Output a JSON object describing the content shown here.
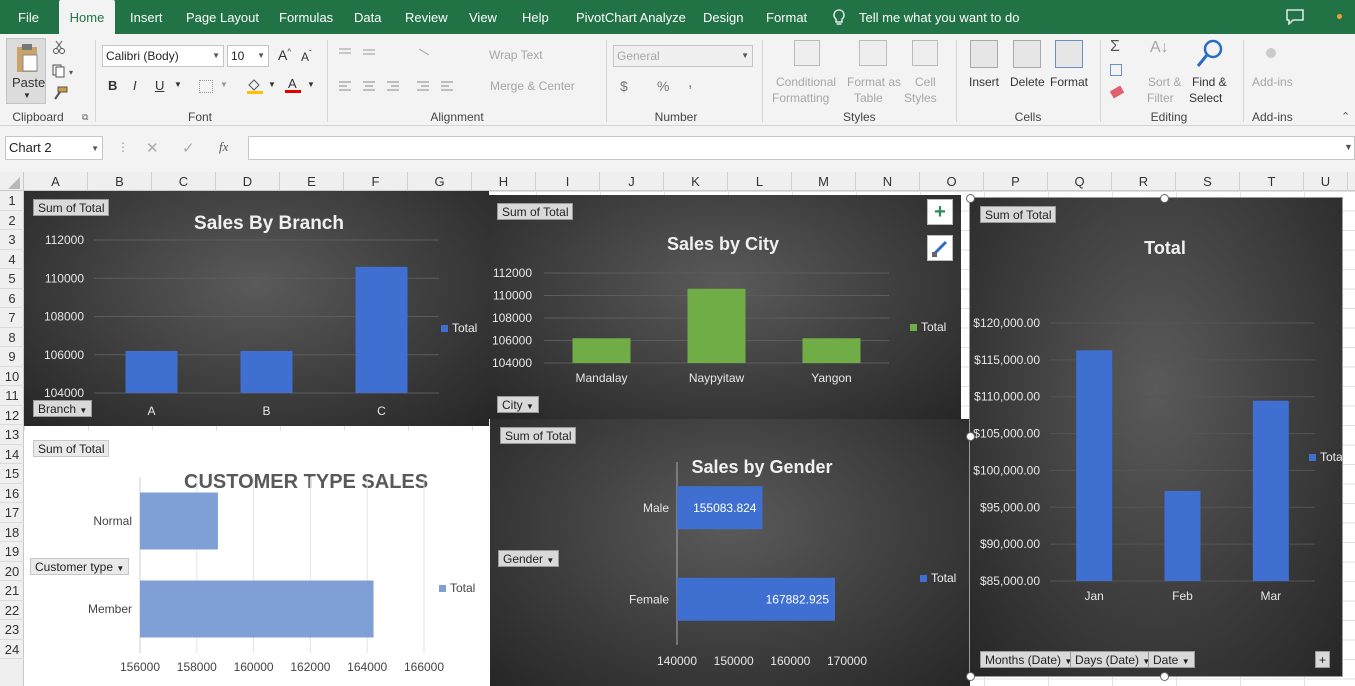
{
  "colors": {
    "excel_green": "#217346",
    "bar_blue": "#3f6fd1",
    "bar_green": "#70ad47",
    "bar_light_blue": "#7f9fd6"
  },
  "tabs": [
    "File",
    "Home",
    "Insert",
    "Page Layout",
    "Formulas",
    "Data",
    "Review",
    "View",
    "Help",
    "PivotChart Analyze",
    "Design",
    "Format"
  ],
  "active_tab": "Home",
  "tell_me": "Tell me what you want to do",
  "ribbon": {
    "clipboard": {
      "paste": "Paste",
      "label": "Clipboard"
    },
    "font": {
      "name": "Calibri (Body)",
      "size": "10",
      "bold": "B",
      "italic": "I",
      "underline": "U",
      "label": "Font"
    },
    "alignment": {
      "wrap": "Wrap Text",
      "merge": "Merge & Center",
      "label": "Alignment"
    },
    "number": {
      "format": "General",
      "currency": "$",
      "percent": "%",
      "comma": ",",
      "label": "Number"
    },
    "styles": {
      "conditional": [
        "Conditional",
        "Formatting"
      ],
      "format_table": [
        "Format as",
        "Table"
      ],
      "cell_styles": [
        "Cell",
        "Styles"
      ],
      "label": "Styles"
    },
    "cells": {
      "insert": "Insert",
      "delete": "Delete",
      "format": "Format",
      "label": "Cells"
    },
    "editing": {
      "sort": [
        "Sort &",
        "Filter"
      ],
      "find": [
        "Find &",
        "Select"
      ],
      "label": "Editing"
    },
    "addins": {
      "button": "Add-ins",
      "label": "Add-ins"
    }
  },
  "formula_bar": {
    "name_box": "Chart 2",
    "fx": "fx",
    "value": ""
  },
  "columns": [
    "A",
    "B",
    "C",
    "D",
    "E",
    "F",
    "G",
    "H",
    "I",
    "J",
    "K",
    "L",
    "M",
    "N",
    "O",
    "P",
    "Q",
    "R",
    "S",
    "T",
    "U"
  ],
  "rows": [
    "1",
    "2",
    "3",
    "4",
    "5",
    "6",
    "7",
    "8",
    "9",
    "10",
    "11",
    "12",
    "13",
    "14",
    "15",
    "16",
    "17",
    "18",
    "19",
    "20",
    "21",
    "22",
    "23",
    "24"
  ],
  "chart_data": [
    {
      "id": "branch",
      "type": "bar",
      "title": "Sales By Branch",
      "field_button": "Sum of Total",
      "axis_button": "Branch",
      "categories": [
        "A",
        "B",
        "C"
      ],
      "series": [
        {
          "name": "Total",
          "values": [
            106200,
            106200,
            110600
          ]
        }
      ],
      "yticks": [
        "112000",
        "110000",
        "108000",
        "106000",
        "104000"
      ],
      "ylim": [
        104000,
        112000
      ],
      "legend": "right"
    },
    {
      "id": "city",
      "type": "bar",
      "title": "Sales by City",
      "field_button": "Sum of Total",
      "axis_button": "City",
      "categories": [
        "Mandalay",
        "Naypyitaw",
        "Yangon"
      ],
      "series": [
        {
          "name": "Total",
          "values": [
            106200,
            110600,
            106200
          ]
        }
      ],
      "yticks": [
        "112000",
        "110000",
        "108000",
        "106000",
        "104000"
      ],
      "ylim": [
        104000,
        112000
      ],
      "legend": "right"
    },
    {
      "id": "customer",
      "type": "bar",
      "orientation": "horizontal",
      "title": "CUSTOMER TYPE SALES",
      "field_button": "Sum of Total",
      "axis_button": "Customer type",
      "categories": [
        "Normal",
        "Member"
      ],
      "series": [
        {
          "name": "Total",
          "values": [
            158743,
            164223
          ]
        }
      ],
      "xticks": [
        "156000",
        "158000",
        "160000",
        "162000",
        "164000",
        "166000"
      ],
      "xlim": [
        156000,
        166000
      ],
      "legend": "right"
    },
    {
      "id": "gender",
      "type": "bar",
      "orientation": "horizontal",
      "title": "Sales by Gender",
      "field_button": "Sum of Total",
      "axis_button": "Gender",
      "categories": [
        "Male",
        "Female"
      ],
      "series": [
        {
          "name": "Total",
          "values": [
            155083.824,
            167882.925
          ]
        }
      ],
      "value_labels": [
        "155083.824",
        "167882.925"
      ],
      "xticks": [
        "140000",
        "150000",
        "160000",
        "170000"
      ],
      "xlim": [
        140000,
        170000
      ],
      "legend": "right"
    },
    {
      "id": "months",
      "type": "bar",
      "title": "Total",
      "field_button": "Sum of Total",
      "axis_buttons": [
        "Months (Date)",
        "Days (Date)",
        "Date"
      ],
      "categories": [
        "Jan",
        "Feb",
        "Mar"
      ],
      "series": [
        {
          "name": "Total",
          "values": [
            116292,
            97219,
            109456
          ]
        }
      ],
      "yticks": [
        "$120,000.00",
        "$115,000.00",
        "$110,000.00",
        "$105,000.00",
        "$100,000.00",
        "$95,000.00",
        "$90,000.00",
        "$85,000.00"
      ],
      "ylim": [
        85000,
        120000
      ],
      "legend": "right",
      "legend_label": "Tota"
    }
  ]
}
